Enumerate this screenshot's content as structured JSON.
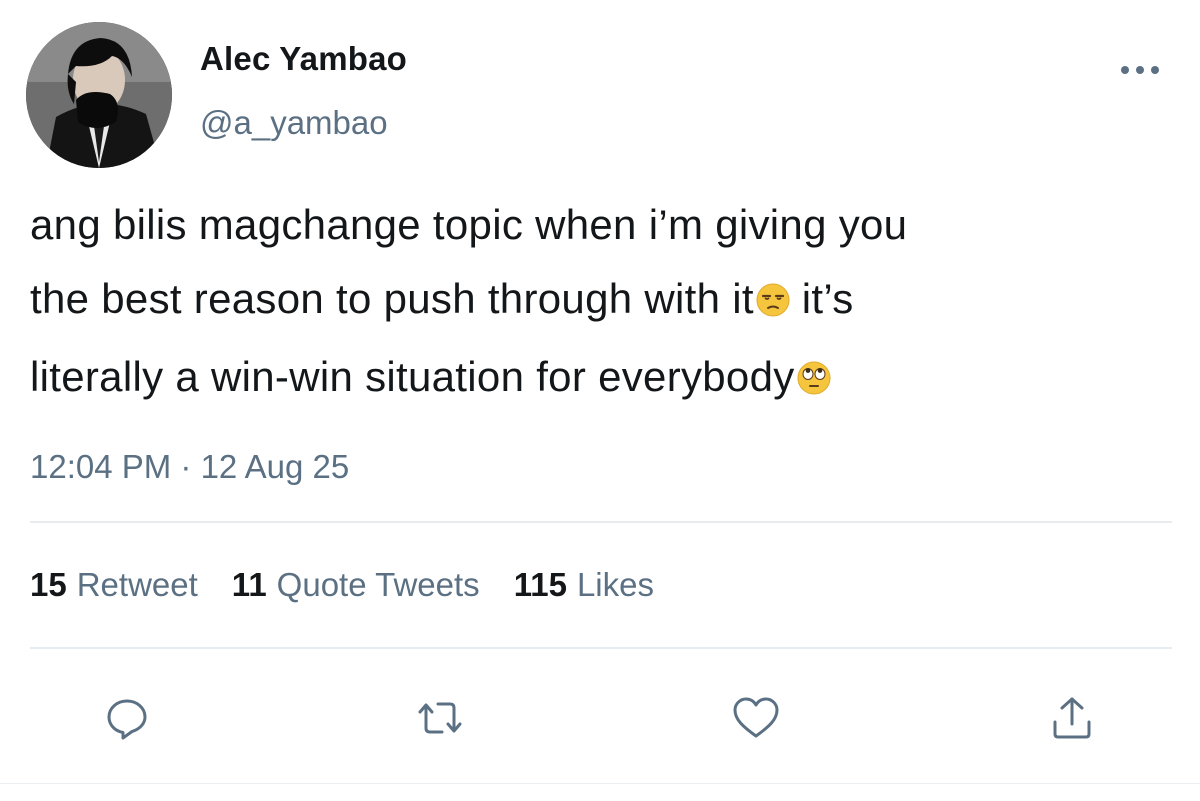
{
  "author": {
    "display_name": "Alec Yambao",
    "handle": "@a_yambao",
    "avatar_icon": "profile-photo"
  },
  "tweet": {
    "lines": [
      "ang bilis magchange topic when i’m giving you",
      "the best reason to push through with it",
      " it’s",
      "literally a win-win situation for everybody"
    ],
    "emojis": [
      "unamused-face",
      "face-with-rolling-eyes"
    ],
    "timestamp": "12:04 PM · 12 Aug 25"
  },
  "stats": [
    {
      "count": "15",
      "label": "Retweet"
    },
    {
      "count": "11",
      "label": "Quote Tweets"
    },
    {
      "count": "115",
      "label": "Likes"
    }
  ],
  "actions": {
    "icons": [
      "reply-icon",
      "retweet-icon",
      "like-icon",
      "share-icon"
    ]
  },
  "colors": {
    "primary_text": "#14171a",
    "secondary_text": "#5b7083",
    "divider": "#e6ecf0"
  }
}
